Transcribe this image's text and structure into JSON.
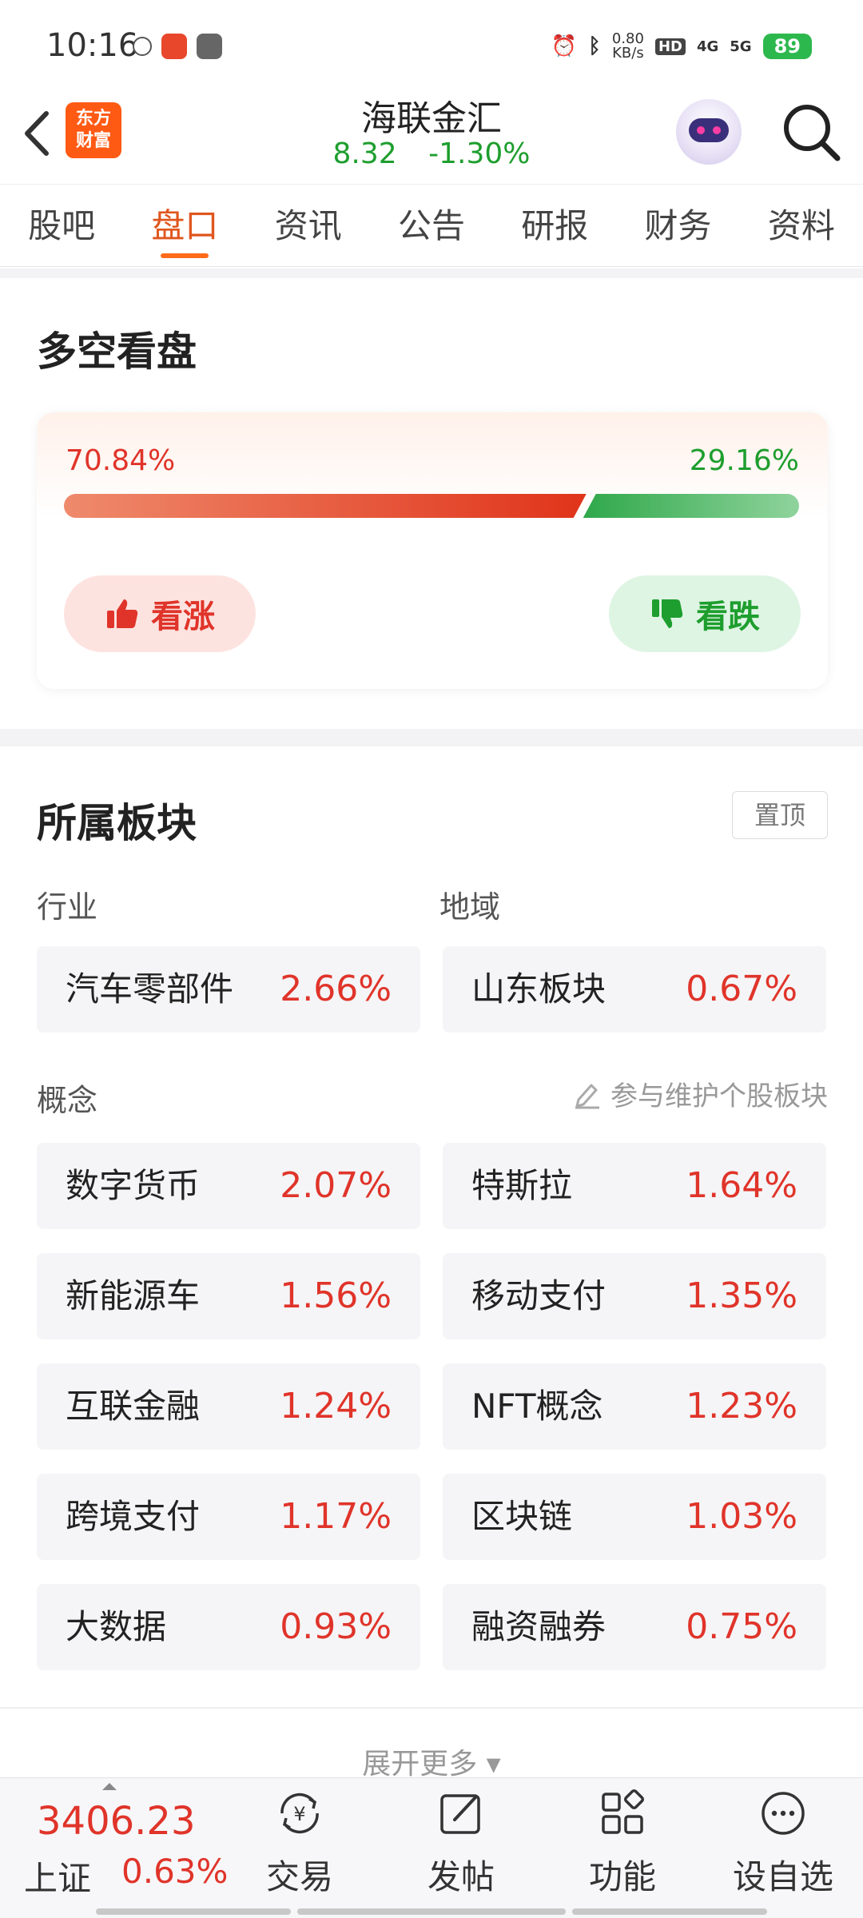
{
  "status_bar": {
    "time": "10:16",
    "net_speed_value": "0.80",
    "net_speed_unit": "KB/s",
    "hd": "HD",
    "net_4g": "4G",
    "net_5g": "5G",
    "battery": "89"
  },
  "header": {
    "logo_line1": "东方",
    "logo_line2": "财富",
    "stock_name": "海联金汇",
    "price": "8.32",
    "change_pct": "-1.30%"
  },
  "tabs": [
    "股吧",
    "盘口",
    "资讯",
    "公告",
    "研报",
    "财务",
    "资料"
  ],
  "active_tab": "盘口",
  "sentiment": {
    "title": "多空看盘",
    "bull_pct": "70.84%",
    "bear_pct": "29.16%",
    "bull_fraction": 0.7084,
    "bull_label": "看涨",
    "bear_label": "看跌"
  },
  "sectors": {
    "title": "所属板块",
    "pin_label": "置顶",
    "industry_label": "行业",
    "region_label": "地域",
    "industry": {
      "name": "汽车零部件",
      "pct": "2.66%"
    },
    "region": {
      "name": "山东板块",
      "pct": "0.67%"
    },
    "concept_label": "概念",
    "maintain_label": "参与维护个股板块",
    "concepts": [
      {
        "name": "数字货币",
        "pct": "2.07%"
      },
      {
        "name": "特斯拉",
        "pct": "1.64%"
      },
      {
        "name": "新能源车",
        "pct": "1.56%"
      },
      {
        "name": "移动支付",
        "pct": "1.35%"
      },
      {
        "name": "互联金融",
        "pct": "1.24%"
      },
      {
        "name": "NFT概念",
        "pct": "1.23%"
      },
      {
        "name": "跨境支付",
        "pct": "1.17%"
      },
      {
        "name": "区块链",
        "pct": "1.03%"
      },
      {
        "name": "大数据",
        "pct": "0.93%"
      },
      {
        "name": "融资融券",
        "pct": "0.75%"
      }
    ],
    "expand_label": "展开更多 ▾"
  },
  "bottom_bar": {
    "index_value": "3406.23",
    "index_name": "上证",
    "index_pct": "0.63%",
    "nav": [
      {
        "label": "交易",
        "icon": "trade-icon"
      },
      {
        "label": "发帖",
        "icon": "post-icon"
      },
      {
        "label": "功能",
        "icon": "functions-icon"
      },
      {
        "label": "设自选",
        "icon": "watchlist-icon"
      }
    ]
  },
  "colors": {
    "up": "#e0342a",
    "down": "#1e9e2e",
    "accent": "#ff6a1a"
  }
}
